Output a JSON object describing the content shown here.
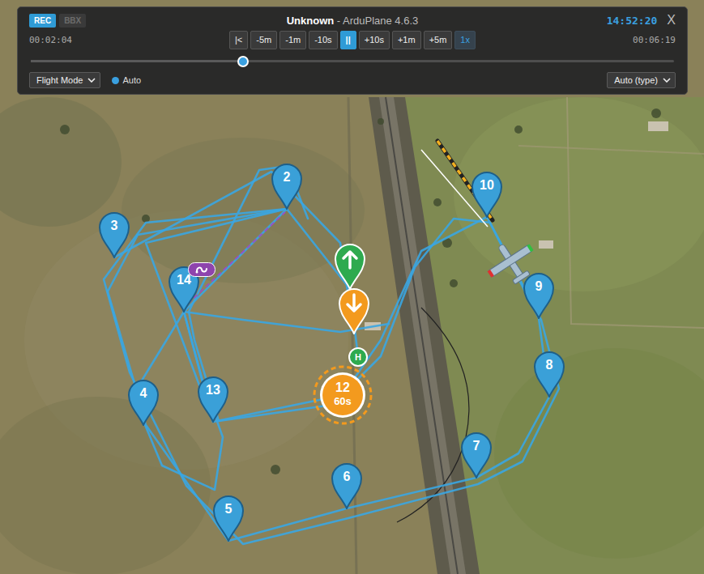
{
  "recorder": {
    "tabs": [
      {
        "label": "REC",
        "selected": true
      },
      {
        "label": "BBX",
        "selected": false
      }
    ]
  },
  "title": "Unknown",
  "subtitle": "- ArduPlane 4.6.3",
  "clock": "14:52:20",
  "close": "X",
  "elapsed": "00:02:04",
  "duration": "00:06:19",
  "controls": [
    {
      "label": "|<",
      "selected": false,
      "kind": "step"
    },
    {
      "label": "-5m",
      "selected": false,
      "kind": "step"
    },
    {
      "label": "-1m",
      "selected": false,
      "kind": "step"
    },
    {
      "label": "-10s",
      "selected": false,
      "kind": "step"
    },
    {
      "label": "||",
      "selected": true,
      "kind": "play"
    },
    {
      "label": "+10s",
      "selected": false,
      "kind": "step"
    },
    {
      "label": "+1m",
      "selected": false,
      "kind": "step"
    },
    {
      "label": "+5m",
      "selected": false,
      "kind": "step"
    },
    {
      "label": "1x",
      "selected": false,
      "kind": "speed"
    }
  ],
  "timeline": {
    "level": 0.33
  },
  "mode_select": {
    "label": "Flight Mode"
  },
  "mode": {
    "label": "Auto",
    "color": "#3aa0e0"
  },
  "color_select": {
    "label": "Auto (type)"
  },
  "map": {
    "waypoints": [
      {
        "label": "2",
        "kind": "waypoint",
        "selected": false
      },
      {
        "label": "3",
        "kind": "waypoint",
        "selected": false
      },
      {
        "label": "4",
        "kind": "waypoint",
        "selected": false
      },
      {
        "label": "5",
        "kind": "waypoint",
        "selected": false
      },
      {
        "label": "6",
        "kind": "waypoint",
        "selected": false
      },
      {
        "label": "7",
        "kind": "waypoint",
        "selected": false
      },
      {
        "label": "8",
        "kind": "waypoint",
        "selected": false
      },
      {
        "label": "9",
        "kind": "waypoint",
        "selected": false
      },
      {
        "label": "10",
        "kind": "waypoint",
        "selected": false
      },
      {
        "label": "12",
        "time": "60s",
        "kind": "loiter",
        "selected": true
      },
      {
        "label": "13",
        "kind": "waypoint",
        "selected": false
      },
      {
        "label": "14",
        "kind": "waypoint",
        "selected": false
      }
    ],
    "markers": [
      {
        "kind": "takeoff",
        "color": "#2eaa4f"
      },
      {
        "kind": "land",
        "color": "#f39a1e"
      },
      {
        "kind": "home",
        "label": "H",
        "color": "#2eaa4f"
      },
      {
        "kind": "jump",
        "color": "#8e44ad"
      }
    ]
  }
}
